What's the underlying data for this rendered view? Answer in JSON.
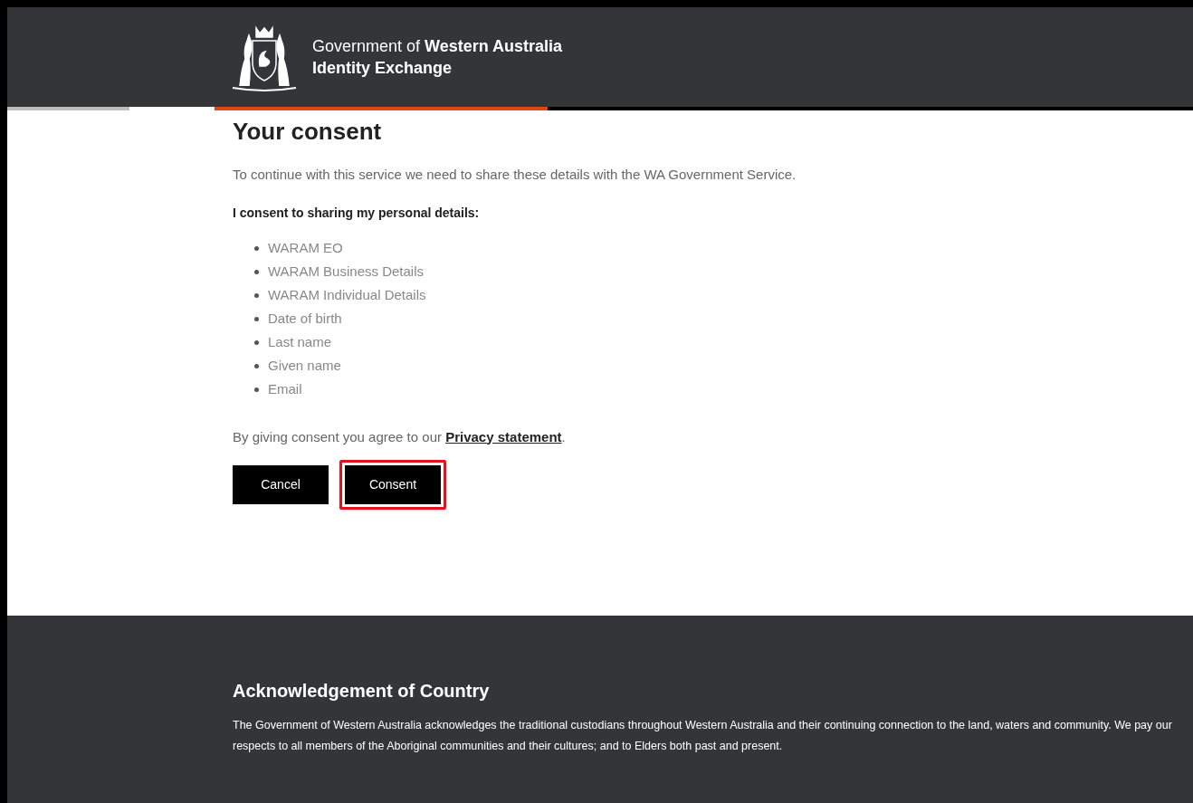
{
  "header": {
    "title_prefix": "Government of",
    "title_bold": "Western Australia",
    "subtitle": "Identity Exchange"
  },
  "main": {
    "heading": "Your consent",
    "intro": "To continue with this service we need to share these details with the WA Government Service.",
    "consent_label": "I consent to sharing my personal details:",
    "details": [
      "WARAM EO",
      "WARAM Business Details",
      "WARAM Individual Details",
      "Date of birth",
      "Last name",
      "Given name",
      "Email"
    ],
    "privacy_text": "By giving consent you agree to our",
    "privacy_link": "Privacy statement",
    "privacy_end": ".",
    "buttons": [
      {
        "label": "Cancel",
        "highlighted": false
      },
      {
        "label": "Consent",
        "highlighted": true
      }
    ]
  },
  "footer": {
    "heading": "Acknowledgement of Country",
    "text": "The Government of Western Australia acknowledges the traditional custodians throughout Western Australia and their continuing connection to the land, waters and community. We pay our respects to all members of the Aboriginal communities and their cultures; and to Elders both past and present."
  }
}
